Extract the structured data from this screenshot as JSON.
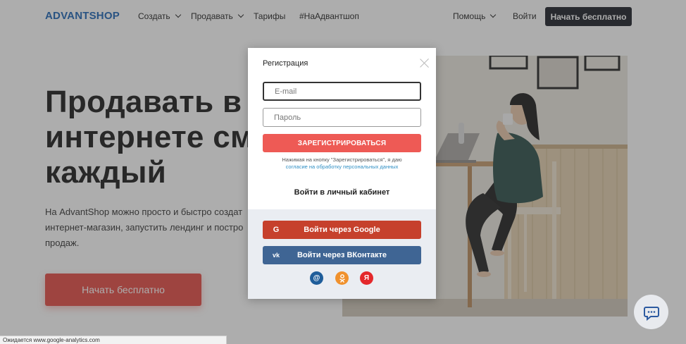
{
  "header": {
    "logo": "ADVANTSHOP",
    "nav": [
      {
        "label": "Создать",
        "has_dropdown": true
      },
      {
        "label": "Продавать",
        "has_dropdown": true
      },
      {
        "label": "Тарифы",
        "has_dropdown": false
      },
      {
        "label": "#НаАдвантшоп",
        "has_dropdown": false
      }
    ],
    "help": "Помощь",
    "login": "Войти",
    "cta": "Начать бесплатно"
  },
  "hero": {
    "title_lines": [
      "Продавать в",
      "интернете смо",
      "каждый"
    ],
    "description": "На AdvantShop можно просто и быстро создат интернет-магазин, запустить лендинг и постро продаж.",
    "cta": "Начать бесплатно"
  },
  "modal": {
    "title": "Регистрация",
    "email_placeholder": "E-mail",
    "password_placeholder": "Пароль",
    "register_button": "ЗАРЕГИСТРИРОВАТЬСЯ",
    "agree_text": "Нажимая на кнопку \"Зарегистрироваться\", я даю",
    "agree_link": "согласие на обработку персональных данных",
    "login_link": "Войти в личный кабинет",
    "google_button": "Войти через Google",
    "vk_button": "Войти через ВКонтакте",
    "mini_socials": [
      {
        "name": "mail-ru",
        "glyph": "@",
        "color": "#1f5d9a"
      },
      {
        "name": "odnoklassniki",
        "glyph": "ок",
        "color": "#f0912d"
      },
      {
        "name": "yandex",
        "glyph": "Я",
        "color": "#e4282b"
      }
    ]
  },
  "status_bar": "Ожидается www.google-analytics.com",
  "colors": {
    "brand": "#1d64b6",
    "accent": "#ee5a55",
    "google": "#c6402c",
    "vk": "#3f6594"
  }
}
